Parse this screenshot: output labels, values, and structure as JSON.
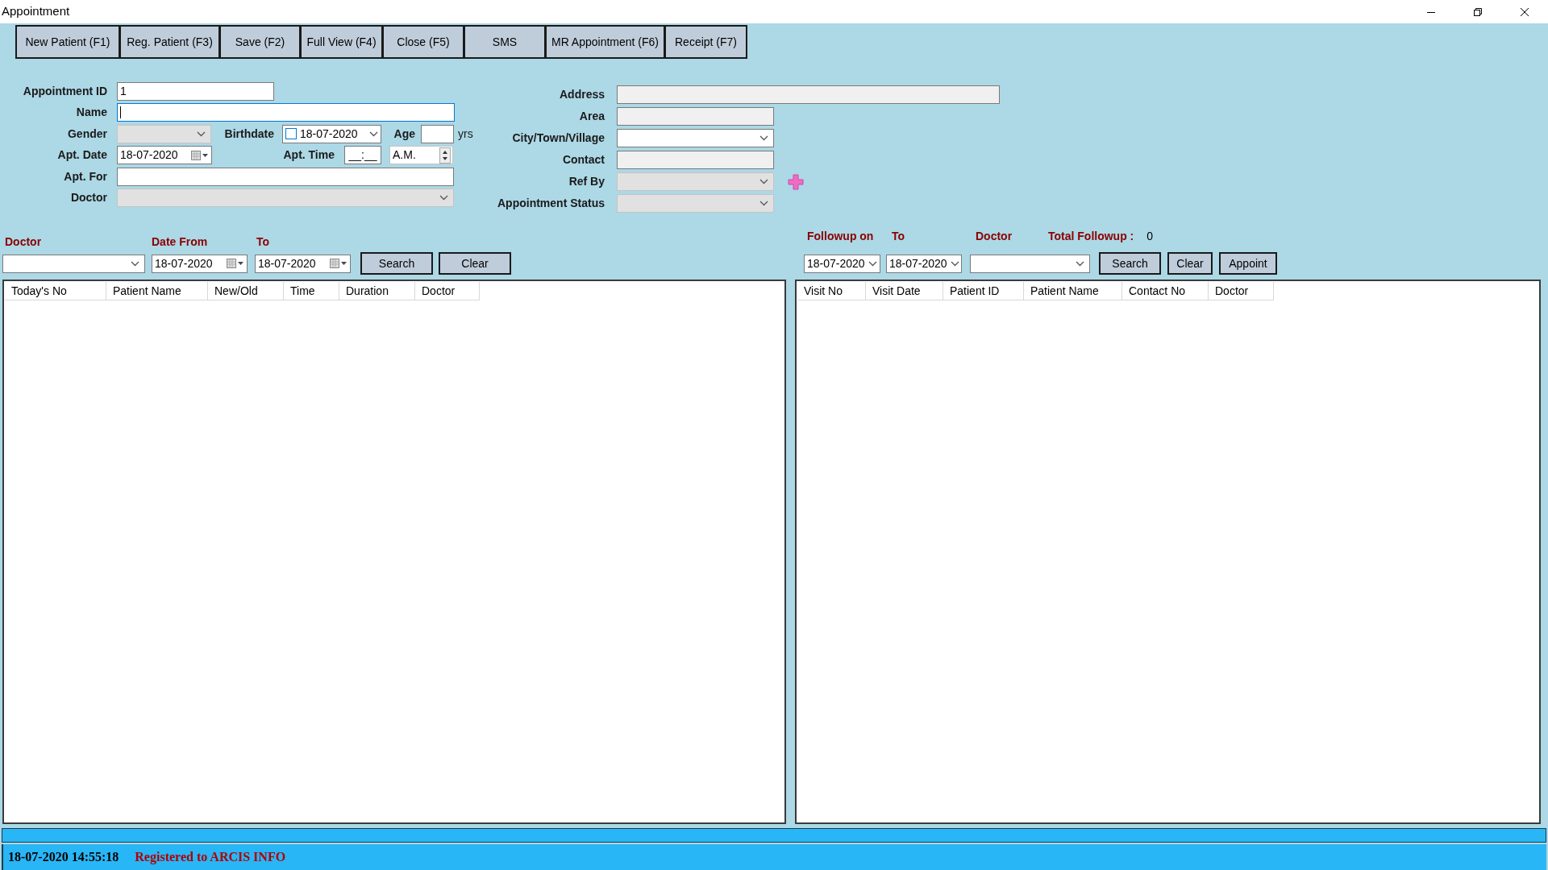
{
  "window": {
    "title": "Appointment"
  },
  "toolbar": [
    {
      "label": "New Patient (F1)"
    },
    {
      "label": "Reg. Patient (F3)"
    },
    {
      "label": "Save (F2)"
    },
    {
      "label": "Full View (F4)"
    },
    {
      "label": "Close (F5)"
    },
    {
      "label": "SMS"
    },
    {
      "label": "MR Appointment (F6)"
    },
    {
      "label": "Receipt (F7)"
    }
  ],
  "form_left": [
    [
      {
        "label": "Appointment ID",
        "kind": "text",
        "value": "1",
        "focused": false
      }
    ],
    [
      {
        "label": "Name",
        "kind": "text",
        "focused": true
      }
    ],
    [
      {
        "label": "Gender",
        "kind": "combo",
        "disabled": true
      },
      {
        "label": "Birthdate",
        "kind": "date",
        "value": "18-07-2020",
        "checked": false
      },
      {
        "label": "Age",
        "kind": "text",
        "focused": false,
        "suffix": "yrs"
      }
    ],
    [
      {
        "label": "Apt. Date",
        "kind": "calendar",
        "value": "18-07-2020"
      },
      {
        "label": "Apt. Time",
        "kind": "masked",
        "value": "__:__"
      },
      {
        "kind": "spinner",
        "value": "A.M."
      }
    ],
    [
      {
        "label": "Apt. For",
        "kind": "text",
        "focused": false
      }
    ],
    [
      {
        "label": "Doctor",
        "kind": "combo",
        "disabled": true
      }
    ]
  ],
  "form_right": [
    {
      "label": "Address",
      "kind": "text",
      "read_only": true
    },
    {
      "label": "Area",
      "kind": "text",
      "read_only": true
    },
    {
      "label": "City/Town/Village",
      "kind": "combo",
      "disabled": false
    },
    {
      "label": "Contact",
      "kind": "text",
      "read_only": true
    },
    {
      "label": "Ref By",
      "kind": "combo",
      "disabled": true,
      "add_button": true
    },
    {
      "label": "Appointment Status",
      "kind": "combo",
      "disabled": true
    }
  ],
  "appointments": {
    "filters": [
      {
        "label": "Doctor",
        "kind": "combo",
        "disabled": false
      },
      {
        "label": "Date From",
        "kind": "calendar",
        "value": "18-07-2020"
      },
      {
        "label": "To",
        "kind": "calendar",
        "value": "18-07-2020"
      }
    ],
    "buttons": [
      "Search",
      "Clear"
    ],
    "table": {
      "columns": [
        "Today's No",
        "Patient Name",
        "New/Old",
        "Time",
        "Duration",
        "Doctor"
      ]
    }
  },
  "followups": {
    "filters": [
      {
        "label": "Followup on",
        "kind": "date",
        "value": "18-07-2020"
      },
      {
        "label": "To",
        "kind": "date",
        "value": "18-07-2020"
      },
      {
        "label": "Doctor",
        "kind": "combo",
        "disabled": false
      }
    ],
    "total": {
      "label": "Total Followup :",
      "value": "0"
    },
    "buttons": [
      "Search",
      "Clear",
      "Appoint"
    ],
    "table": {
      "columns": [
        "Visit No",
        "Visit Date",
        "Patient ID",
        "Patient Name",
        "Contact No",
        "Doctor"
      ]
    }
  },
  "progress": {
    "level": 1
  },
  "status_bar": {
    "datetime": "18-07-2020 14:55:18",
    "registration": "Registered to ARCIS INFO"
  }
}
